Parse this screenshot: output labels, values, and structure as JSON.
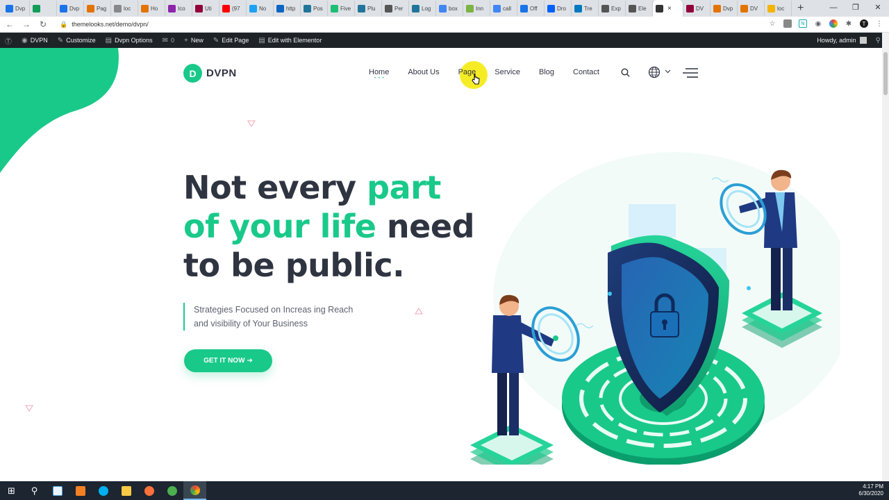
{
  "browser": {
    "tabs": [
      {
        "label": "Dvp",
        "color": "#1a73e8"
      },
      {
        "label": "",
        "color": "#0f9d58"
      },
      {
        "label": "Dvp",
        "color": "#1a73e8"
      },
      {
        "label": "Pag",
        "color": "#e37400"
      },
      {
        "label": "loc",
        "color": "#888888"
      },
      {
        "label": "Ho",
        "color": "#e37400"
      },
      {
        "label": "Ico",
        "color": "#8e24aa"
      },
      {
        "label": "Uti",
        "color": "#92003b"
      },
      {
        "label": "(97",
        "color": "#ff0000"
      },
      {
        "label": "No",
        "color": "#1da1f2"
      },
      {
        "label": "http",
        "color": "#0a66c2"
      },
      {
        "label": "Pos",
        "color": "#21759b"
      },
      {
        "label": "Five",
        "color": "#1dbf73"
      },
      {
        "label": "Plu",
        "color": "#21759b"
      },
      {
        "label": "Per",
        "color": "#555555"
      },
      {
        "label": "Log",
        "color": "#21759b"
      },
      {
        "label": "box",
        "color": "#4285f4"
      },
      {
        "label": "Inn",
        "color": "#7cb342"
      },
      {
        "label": "call",
        "color": "#4285f4"
      },
      {
        "label": "Off",
        "color": "#1a73e8"
      },
      {
        "label": "Dro",
        "color": "#0061ff"
      },
      {
        "label": "Tre",
        "color": "#0079bf"
      },
      {
        "label": "Exp",
        "color": "#555555"
      },
      {
        "label": "Ele",
        "color": "#555555"
      },
      {
        "label": "",
        "color": "#333333",
        "active": true
      },
      {
        "label": "DV",
        "color": "#92003b"
      },
      {
        "label": "Dvp",
        "color": "#e37400"
      },
      {
        "label": "DV",
        "color": "#e37400"
      },
      {
        "label": "loc",
        "color": "#f4b400"
      }
    ],
    "url": "themelooks.net/demo/dvpn/",
    "close_glyph": "×",
    "newtab_glyph": "+"
  },
  "wpbar": {
    "site": "DVPN",
    "customize": "Customize",
    "options": "Dvpn Options",
    "comments": "0",
    "new": "New",
    "edit_page": "Edit Page",
    "elementor": "Edit with Elementor",
    "howdy": "Howdy, admin"
  },
  "site": {
    "logo_letter": "D",
    "logo_text": "DVPN",
    "nav": [
      "Home",
      "About Us",
      "Page",
      "Service",
      "Blog",
      "Contact"
    ],
    "hero": {
      "line1a": "Not every ",
      "line1b": "part",
      "line2a": "of your life",
      "line2b": " need",
      "line3": "to be public."
    },
    "subtitle_1": "Strategies Focused on Increas ing Reach",
    "subtitle_2": "and visibility of Your Business",
    "cta": "GET IT NOW",
    "cta_arrow": "➔"
  },
  "colors": {
    "accent": "#19c98a",
    "text": "#2f3441"
  },
  "taskbar": {
    "time": "4:17 PM",
    "date": "6/30/2020"
  }
}
